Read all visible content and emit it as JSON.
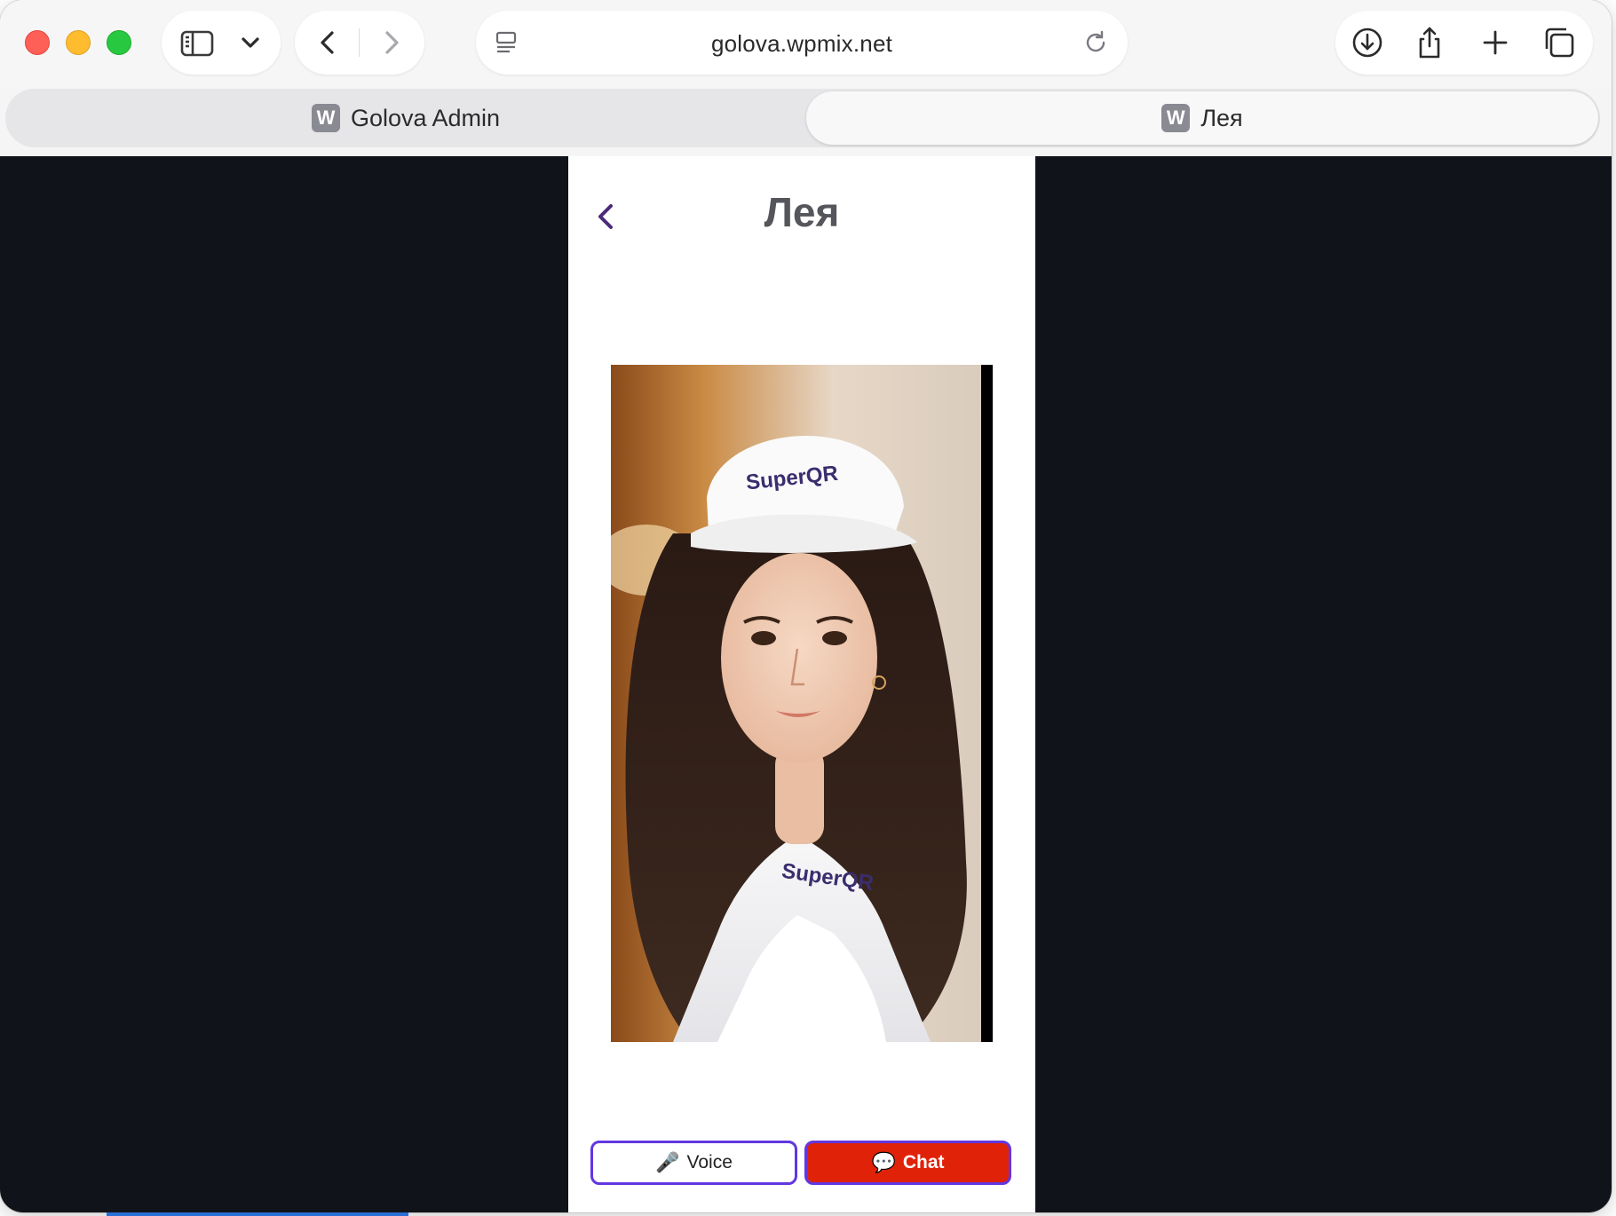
{
  "browser": {
    "url": "golova.wpmix.net",
    "tabs": [
      {
        "label": "Golova Admin",
        "favicon": "W",
        "active": false
      },
      {
        "label": "Лея",
        "favicon": "W",
        "active": true
      }
    ],
    "icons": {
      "sidebar": "sidebar-icon",
      "dropdown": "chevron-down-icon",
      "back": "chevron-left-icon",
      "forward": "chevron-right-icon",
      "reader": "reader-icon",
      "reload": "reload-icon",
      "download": "download-icon",
      "share": "share-icon",
      "new_tab": "plus-icon",
      "tab_overview": "tabs-icon"
    }
  },
  "page": {
    "title": "Лея",
    "back_icon": "chevron-left-icon",
    "portrait": {
      "cap_logo": "SuperQR",
      "shirt_logo": "SuperQR"
    },
    "buttons": {
      "voice": {
        "icon": "🎤",
        "label": "Voice"
      },
      "chat": {
        "icon": "💬",
        "label": "Chat"
      }
    }
  },
  "colors": {
    "accent_purple": "#6237e0",
    "chat_red": "#e02208",
    "page_background": "#11131a",
    "title_gray": "#55565c"
  }
}
